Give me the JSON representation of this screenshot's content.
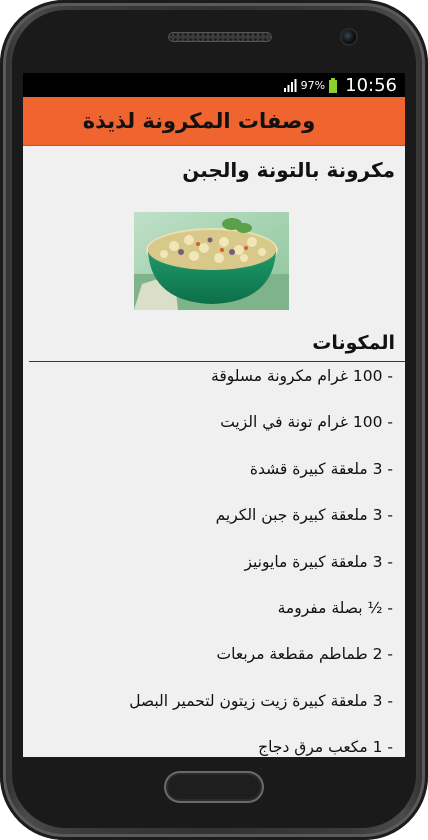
{
  "status_bar": {
    "battery_percent": "97%",
    "time": "10:56",
    "signal_icon": "signal-icon",
    "battery_icon": "battery-icon",
    "battery_color": "#8ad12f"
  },
  "action_bar": {
    "title": "وصفات المكرونة لذيذة",
    "background_color": "#f06430"
  },
  "recipe": {
    "title": "مكرونة بالتونة والجبن",
    "image_icon": "pasta-salad-bowl-image"
  },
  "ingredients_section": {
    "heading": "المكونات",
    "divider_color": "#b00020",
    "items": [
      "- 100 غرام مكرونة مسلوقة",
      "- 100 غرام تونة في الزيت",
      "- 3 ملعقة كبيرة قشدة",
      "- 3 ملعقة كبيرة جبن الكريم",
      "- 3 ملعقة كبيرة مايونيز",
      "- ½ بصلة مفرومة",
      "- 2 طماطم مقطعة مربعات",
      "- 3 ملعقة كبيرة زيت زيتون لتحمير البصل",
      "- 1 مكعب مرق دجاج"
    ]
  }
}
